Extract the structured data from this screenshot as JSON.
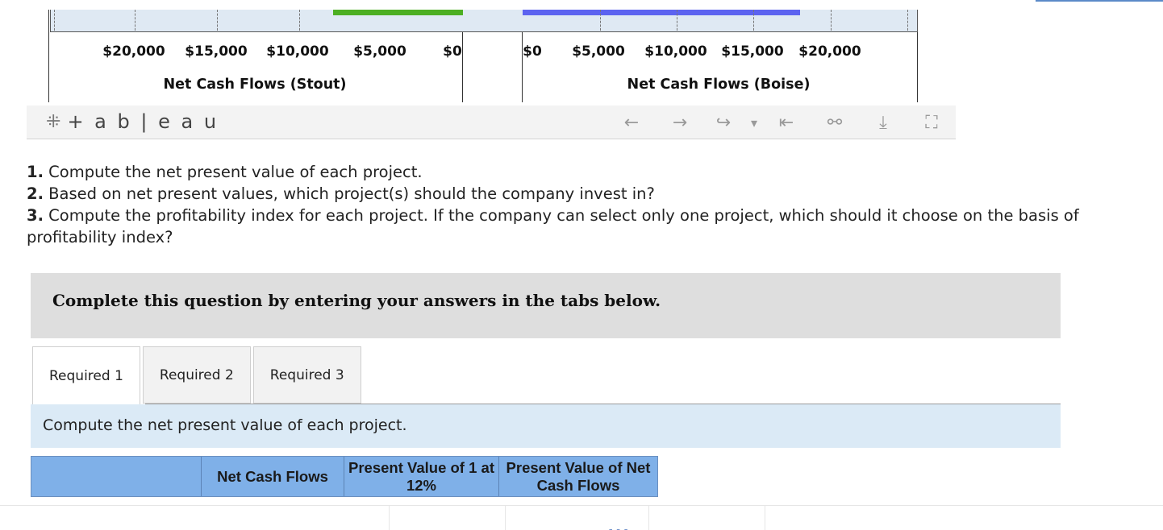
{
  "chart": {
    "stout": {
      "ticks": [
        "$20,000",
        "$15,000",
        "$10,000",
        "$5,000",
        "$0"
      ],
      "title": "Net Cash Flows (Stout)",
      "bar_color": "#4caf22"
    },
    "boise": {
      "ticks": [
        "$0",
        "$5,000",
        "$10,000",
        "$15,000",
        "$20,000"
      ],
      "title": "Net Cash Flows (Boise)",
      "bar_color": "#5c63f0"
    }
  },
  "toolbar": {
    "logo_text": "+ a b | e a u",
    "buttons": [
      {
        "name": "undo-icon",
        "glyph": "←"
      },
      {
        "name": "redo-icon",
        "glyph": "→"
      },
      {
        "name": "revert-icon",
        "glyph": "↪"
      },
      {
        "name": "dropdown-arrow-icon",
        "glyph": "▾"
      },
      {
        "name": "reset-icon",
        "glyph": "⇤"
      },
      {
        "name": "share-icon",
        "glyph": "⚯"
      },
      {
        "name": "download-icon",
        "glyph": "⤓"
      },
      {
        "name": "fullscreen-icon",
        "glyph": "⛶"
      }
    ]
  },
  "questions": [
    {
      "num": "1.",
      "text": " Compute the net present value of each project."
    },
    {
      "num": "2.",
      "text": " Based on net present values, which project(s) should the company invest in?"
    },
    {
      "num": "3.",
      "text": " Compute the profitability index for each project. If the company can select only one project, which should it choose on the basis of profitability index?"
    }
  ],
  "banner": "Complete this question by entering your answers in the tabs below.",
  "tabs": [
    "Required 1",
    "Required 2",
    "Required 3"
  ],
  "active_tab": "Required 1",
  "panel_prompt": "Compute the net present value of each project.",
  "table": {
    "headers": [
      "",
      "Net Cash Flows",
      "Present Value of 1 at 12%",
      "Present Value of Net Cash Flows"
    ]
  },
  "bottom": {
    "dash": "---"
  }
}
